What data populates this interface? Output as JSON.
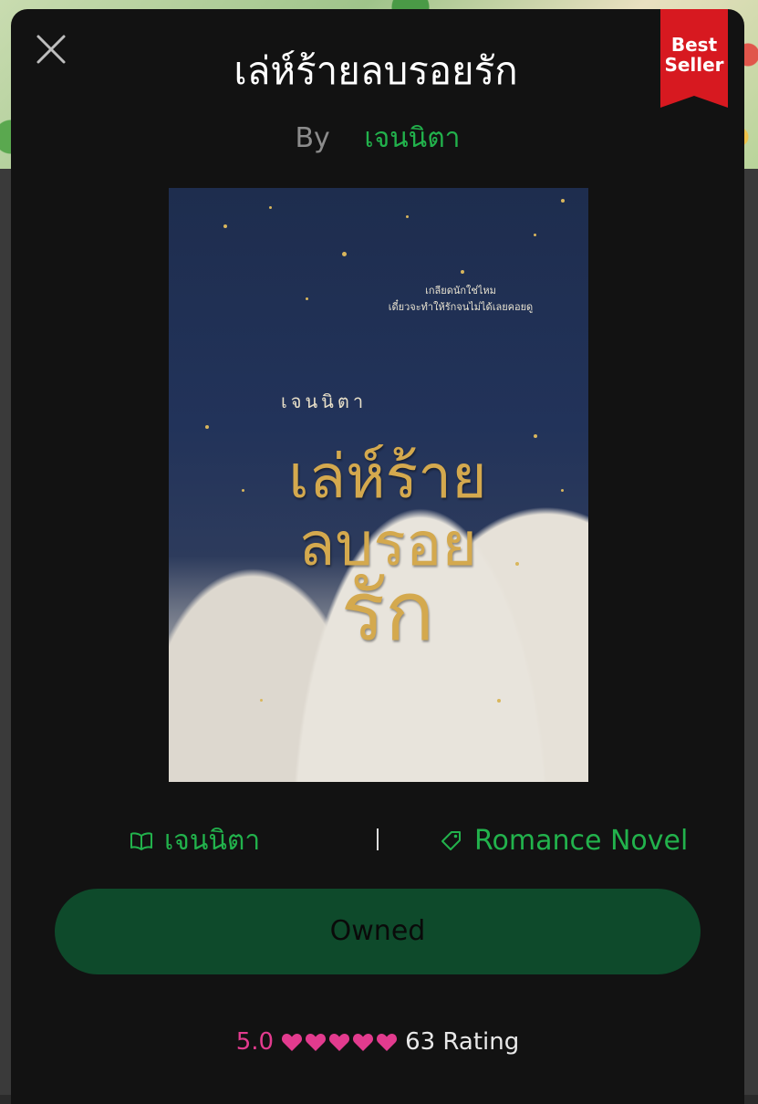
{
  "header": {
    "title": "เล่ห์ร้ายลบรอยรัก",
    "badge_line1": "Best",
    "badge_line2": "Seller"
  },
  "byline": {
    "by_label": "By",
    "author": "เจนนิตา"
  },
  "cover": {
    "tagline_line1": "เกลียดนักใช่ไหม",
    "tagline_line2": "เดี๋ยวจะทำให้รักจนไม่ได้เลยคอยดู",
    "author": "เจนนิตา",
    "title_line1": "เล่ห์ร้าย",
    "title_line2": "ลบรอย",
    "title_line3": "รัก"
  },
  "meta": {
    "author": "เจนนิตา",
    "genre": "Romance Novel"
  },
  "actions": {
    "owned_label": "Owned"
  },
  "rating": {
    "score": "5.0",
    "hearts": 5,
    "count_label": "63 Rating"
  },
  "colors": {
    "accent_green": "#22b24c",
    "button_green": "#0e4a2b",
    "badge_red": "#d71920",
    "heart_pink": "#e23b8e"
  }
}
